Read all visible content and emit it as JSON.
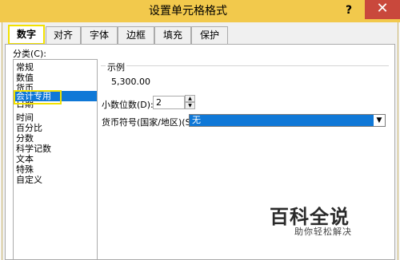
{
  "window": {
    "title": "设置单元格格式",
    "help": "?",
    "close": "✕"
  },
  "tabs": [
    {
      "label": "数字",
      "active": true
    },
    {
      "label": "对齐"
    },
    {
      "label": "字体"
    },
    {
      "label": "边框"
    },
    {
      "label": "填充"
    },
    {
      "label": "保护"
    }
  ],
  "category": {
    "label": "分类(C):",
    "items": [
      "常规",
      "数值",
      "货币",
      "会计专用",
      "日期",
      "时间",
      "百分比",
      "分数",
      "科学记数",
      "文本",
      "特殊",
      "自定义"
    ],
    "selected": "会计专用"
  },
  "sample": {
    "label": "示例",
    "value": "5,300.00"
  },
  "decimal": {
    "label": "小数位数(D):",
    "value": "2"
  },
  "currency": {
    "label": "货币符号(国家/地区)(S):",
    "value": "无"
  },
  "watermark": {
    "title": "百科全说",
    "subtitle": "助你轻松解决"
  },
  "colors": {
    "accent": "#0f78d7",
    "highlight": "#f2e100",
    "titlebar": "#f2c94c",
    "close": "#c9483c"
  }
}
